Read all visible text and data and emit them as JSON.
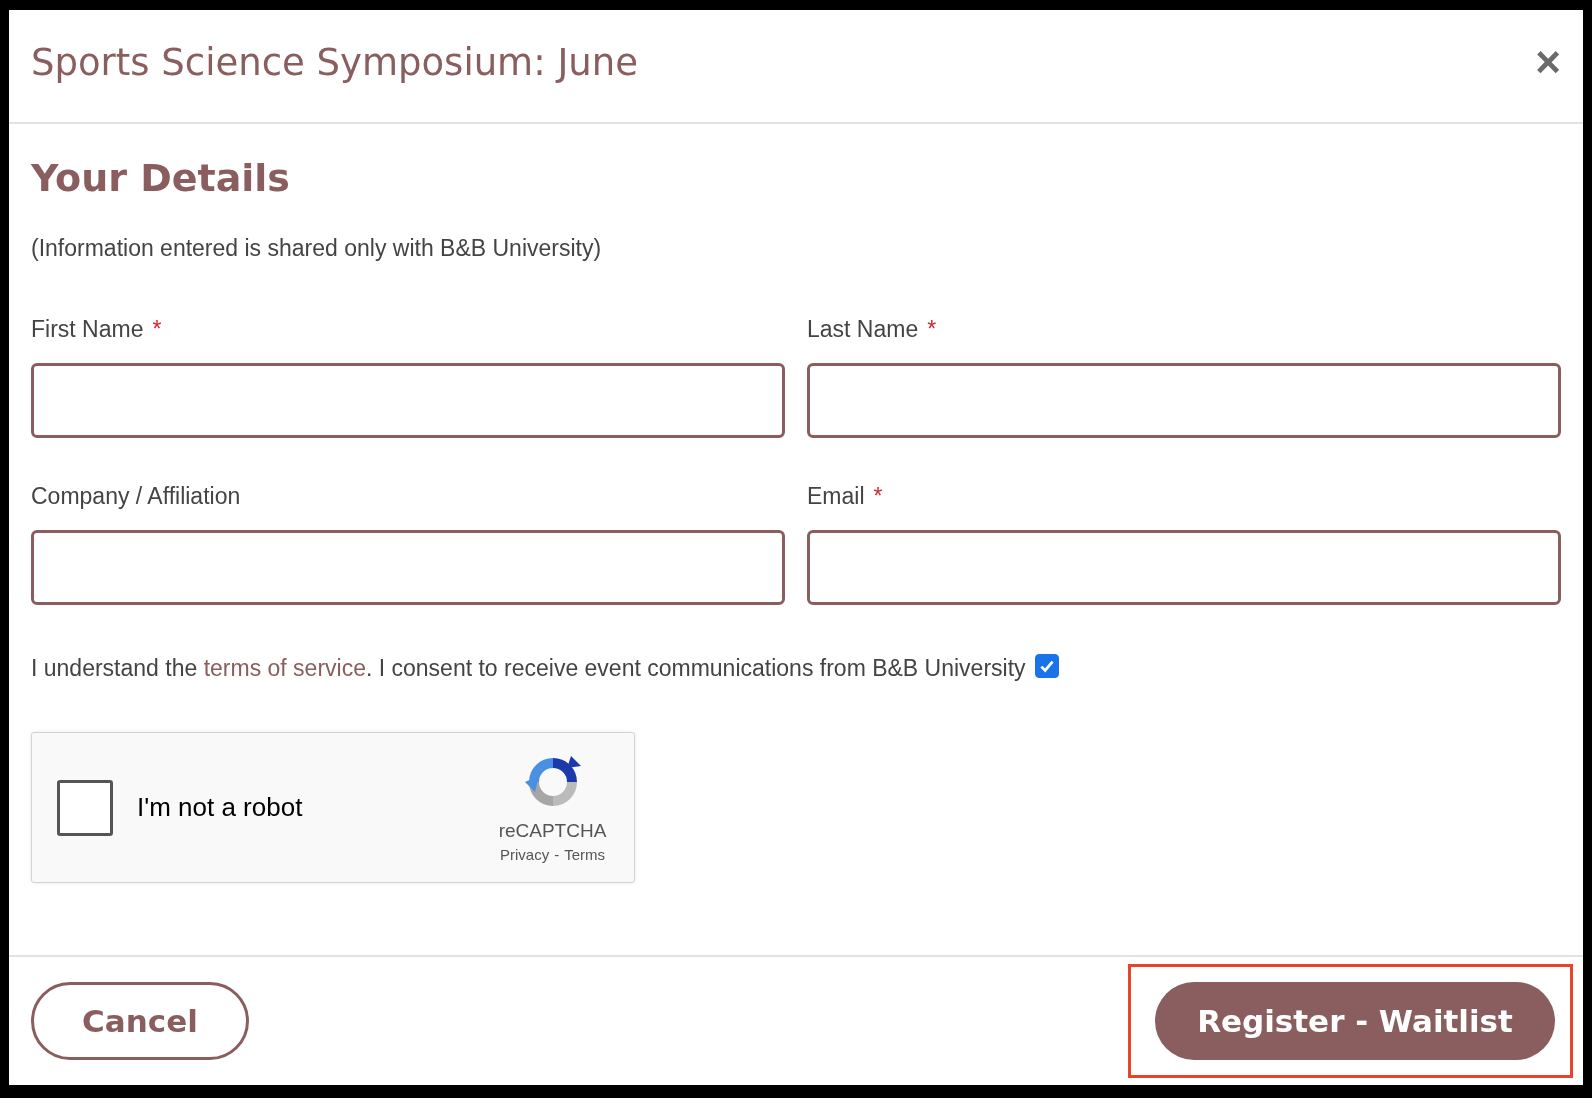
{
  "dialog": {
    "title": "Sports Science Symposium: June",
    "close": "×"
  },
  "section": {
    "heading": "Your Details",
    "note": "(Information entered is shared only with B&B University)"
  },
  "fields": [
    {
      "label": "First Name",
      "required": true
    },
    {
      "label": "Last Name",
      "required": true
    },
    {
      "label": "Company / Affiliation",
      "required": false
    },
    {
      "label": "Email",
      "required": true
    }
  ],
  "required_mark": "*",
  "consent": {
    "before": "I understand the ",
    "link": "terms of service",
    "after": ". I consent to receive event communications from B&B University",
    "checked": true
  },
  "captcha": {
    "label": "I'm not a robot",
    "checked": false,
    "brand": "reCAPTCHA",
    "privacy": "Privacy",
    "separator": "-",
    "terms": "Terms"
  },
  "buttons": [
    {
      "label": "Cancel",
      "kind": "secondary",
      "highlighted": false
    },
    {
      "label": "Register - Waitlist",
      "kind": "primary",
      "highlighted": true
    }
  ]
}
